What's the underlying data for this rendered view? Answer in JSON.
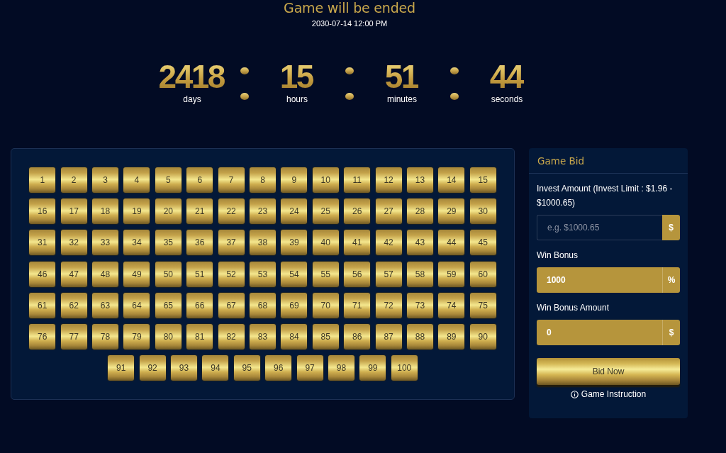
{
  "header": {
    "title": "Game will be ended",
    "end_time": "2030-07-14 12:00 PM"
  },
  "countdown": [
    {
      "value": "2418",
      "unit": "days"
    },
    {
      "value": "15",
      "unit": "hours"
    },
    {
      "value": "51",
      "unit": "minutes"
    },
    {
      "value": "44",
      "unit": "seconds"
    }
  ],
  "number_grid": {
    "numbers": [
      "1",
      "2",
      "3",
      "4",
      "5",
      "6",
      "7",
      "8",
      "9",
      "10",
      "11",
      "12",
      "13",
      "14",
      "15",
      "16",
      "17",
      "18",
      "19",
      "20",
      "21",
      "22",
      "23",
      "24",
      "25",
      "26",
      "27",
      "28",
      "29",
      "30",
      "31",
      "32",
      "33",
      "34",
      "35",
      "36",
      "37",
      "38",
      "39",
      "40",
      "41",
      "42",
      "43",
      "44",
      "45",
      "46",
      "47",
      "48",
      "49",
      "50",
      "51",
      "52",
      "53",
      "54",
      "55",
      "56",
      "57",
      "58",
      "59",
      "60",
      "61",
      "62",
      "63",
      "64",
      "65",
      "66",
      "67",
      "68",
      "69",
      "70",
      "71",
      "72",
      "73",
      "74",
      "75",
      "76",
      "77",
      "78",
      "79",
      "80",
      "81",
      "82",
      "83",
      "84",
      "85",
      "86",
      "87",
      "88",
      "89",
      "90",
      "91",
      "92",
      "93",
      "94",
      "95",
      "96",
      "97",
      "98",
      "99",
      "100"
    ]
  },
  "bid_panel": {
    "title": "Game Bid",
    "fields": [
      {
        "label": "Invest Amount (Invest Limit : $1.96 - $1000.65)",
        "placeholder": "e.g. $1000.65",
        "addon": "$",
        "readonly": false
      },
      {
        "label": "Win Bonus",
        "value": "1000",
        "addon": "%",
        "readonly": true
      },
      {
        "label": "Win Bonus Amount",
        "value": "0",
        "addon": "$",
        "readonly": true
      }
    ],
    "submit_button": "Bid Now",
    "instruction_link": "Game Instruction"
  }
}
